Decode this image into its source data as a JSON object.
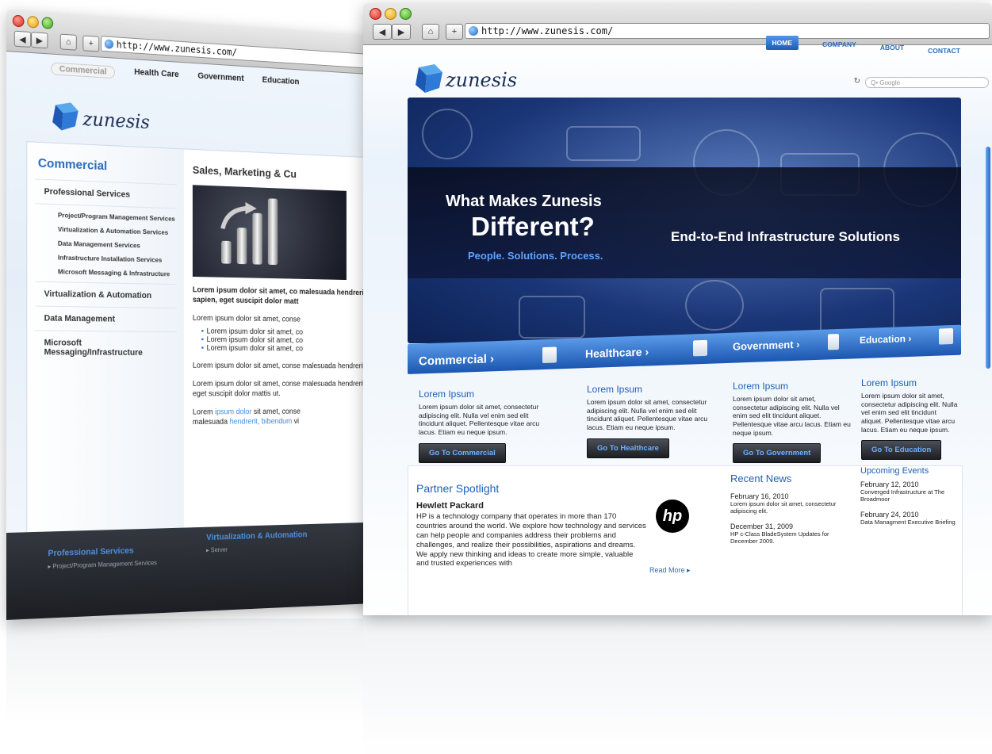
{
  "left_window": {
    "url": "http://www.zunesis.com/",
    "top_nav": [
      "Commercial",
      "Health Care",
      "Government",
      "Education"
    ],
    "logo_text": "zunesis",
    "side_title": "Commercial",
    "sections": [
      {
        "label": "Professional Services"
      },
      {
        "label": "Virtualization & Automation"
      },
      {
        "label": "Data Management"
      },
      {
        "label": "Microsoft Messaging/Infrastructure"
      }
    ],
    "sub_items": [
      "Project/Program Management Services",
      "Virtualization & Automation Services",
      "Data Management Services",
      "Infrastructure Installation Services",
      "Microsoft Messaging & Infrastructure"
    ],
    "main_title": "Sales, Marketing & Cu",
    "bold_para": "Lorem ipsum dolor sit amet, co malesuada hendrerit, bibendum sapien, eget suscipit dolor matt",
    "para1": "Lorem ipsum dolor sit amet, conse",
    "bullets": [
      "Lorem ipsum dolor sit amet, co",
      "Lorem ipsum dolor sit amet, co",
      "Lorem ipsum dolor sit amet, co"
    ],
    "para2": "Lorem ipsum dolor sit amet, conse malesuada hendrerit, bibendum vi",
    "para3": "Lorem ipsum dolor sit amet, conse malesuada hendrerit, bibendum vi eget suscipit dolor mattis ut.",
    "para4_a": "Lorem ",
    "para4_link1": "ipsum dolor",
    "para4_b": " sit amet, conse",
    "para4_c": "malesuada ",
    "para4_link2": "hendrerit, bibendum",
    "para4_d": " vi",
    "footer": {
      "col1_title": "Professional Services",
      "col1_item": "▸ Project/Program Management Services",
      "col2_title": "Virtualization & Automation",
      "col2_item": "▸ Server"
    }
  },
  "right_window": {
    "url": "http://www.zunesis.com/",
    "logo_text": "zunesis",
    "search_placeholder": "Q• Google",
    "nav": [
      "HOME",
      "COMPANY",
      "ABOUT",
      "CONTACT"
    ],
    "hero": {
      "line1": "What Makes Zunesis",
      "line2": "Different?",
      "line3": "People. Solutions. Process.",
      "line4": "End-to-End Infrastructure Solutions"
    },
    "sector_tabs": [
      "Commercial ›",
      "Healthcare ›",
      "Government ›",
      "Education ›"
    ],
    "columns": [
      {
        "title": "Lorem Ipsum",
        "text": "Lorem ipsum dolor sit amet, consectetur adipiscing elit. Nulla vel enim sed elit tincidunt aliquet. Pellentesque vitae arcu lacus. Etiam eu neque ipsum.",
        "button": "Go To Commercial"
      },
      {
        "title": "Lorem Ipsum",
        "text": "Lorem ipsum dolor sit amet, consectetur adipiscing elit. Nulla vel enim sed elit tincidunt aliquet. Pellentesque vitae arcu lacus. Etiam eu neque ipsum.",
        "button": "Go To Healthcare"
      },
      {
        "title": "Lorem Ipsum",
        "text": "Lorem ipsum dolor sit amet, consectetur adipiscing elit. Nulla vel enim sed elit tincidunt aliquet. Pellentesque vitae arcu lacus. Etiam eu neque ipsum.",
        "button": "Go To Government"
      },
      {
        "title": "Lorem Ipsum",
        "text": "Lorem ipsum dolor sit amet, consectetur adipiscing elit. Nulla vel enim sed elit tincidunt aliquet. Pellentesque vitae arcu lacus. Etiam eu neque ipsum.",
        "button": "Go To Education"
      }
    ],
    "partner": {
      "heading": "Partner Spotlight",
      "name": "Hewlett Packard",
      "text": "HP is a technology company that operates in more than 170 countries around the world. We explore how technology and services can help people and companies address their problems and challenges, and realize their possibilities, aspirations and dreams. We apply new thinking and ideas to create more simple, valuable and trusted experiences with",
      "logo": "hp",
      "read_more": "Read More ▸"
    },
    "news": {
      "heading": "Recent News",
      "items": [
        {
          "date": "February 16, 2010",
          "text": "Lorem ipsum dolor sit amet, consectetur adipiscing elit."
        },
        {
          "date": "December 31, 2009",
          "text": "HP c-Class BladeSystem Updates for December 2009."
        }
      ]
    },
    "events": {
      "heading": "Upcoming Events",
      "items": [
        {
          "date": "February 12, 2010",
          "text": "Converged Infrastructure at The Broadmoor"
        },
        {
          "date": "February 24, 2010",
          "text": "Data Managment Executive Briefing"
        }
      ]
    }
  },
  "colors": {
    "brand_blue": "#1f5fb6",
    "accent_blue": "#2a6bbf",
    "dark": "#1c1e22"
  }
}
